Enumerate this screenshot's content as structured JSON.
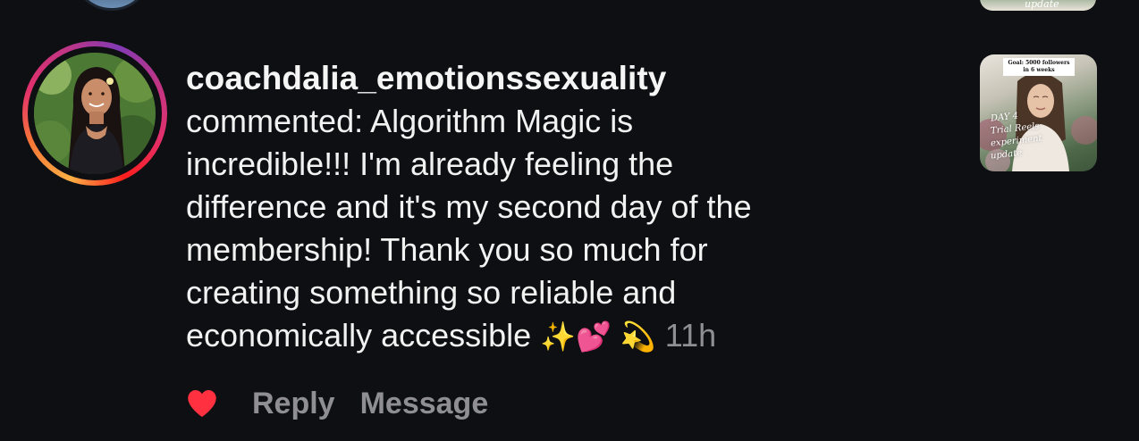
{
  "comment": {
    "username": "coachdalia_emotionssexuality",
    "lines": [
      "commented: Algorithm Magic is",
      "incredible!!! I'm already feeling the",
      "difference and it's my second day of the",
      "membership! Thank you so much for",
      "creating something so reliable and",
      "economically accessible"
    ],
    "emojis": [
      "✨",
      "💕",
      "💫"
    ],
    "time": "11h"
  },
  "actions": {
    "reply_label": "Reply",
    "message_label": "Message"
  },
  "thumbnail": {
    "banner": [
      "Goal: 5000 followers",
      "in 6 weeks"
    ],
    "script": [
      "DAY 4",
      "Trial Reels",
      "experiment",
      "update"
    ]
  },
  "previous_thumbnail": {
    "script": "update"
  },
  "colors": {
    "background": "#0d0f12",
    "text": "#f5f5f5",
    "muted": "#8e8e93",
    "heart": "#ff3040"
  },
  "icons": {
    "like": "heart-icon"
  }
}
